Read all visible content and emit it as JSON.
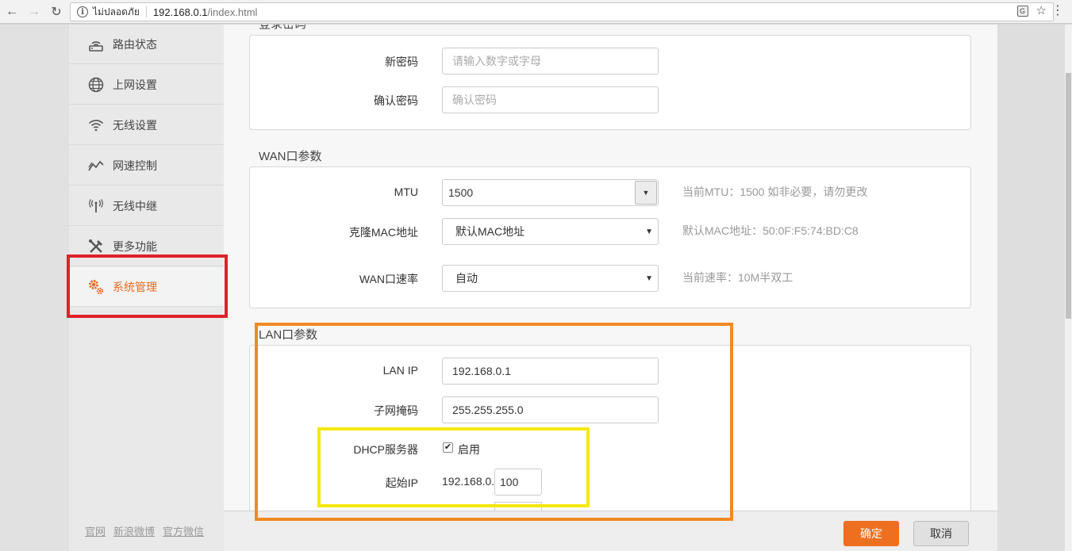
{
  "browser": {
    "back": "←",
    "forward": "→",
    "reload": "↻",
    "security_label": "ไม่ปลอดภัย",
    "url_host": "192.168.0.1",
    "url_path": "/index.html",
    "translate_icon": "translate-icon",
    "star_icon": "star-icon"
  },
  "sidebar": {
    "items": [
      {
        "label": "路由状态",
        "icon": "router-icon"
      },
      {
        "label": "上网设置",
        "icon": "globe-icon"
      },
      {
        "label": "无线设置",
        "icon": "wifi-icon"
      },
      {
        "label": "网速控制",
        "icon": "speed-chart-icon"
      },
      {
        "label": "无线中继",
        "icon": "antenna-icon"
      },
      {
        "label": "更多功能",
        "icon": "tools-icon"
      },
      {
        "label": "系统管理",
        "icon": "gears-icon",
        "active": true
      }
    ],
    "footer_links": [
      "官网",
      "新浪微博",
      "官方微信"
    ]
  },
  "login_password": {
    "title_partial": "登录密码",
    "new_password_label": "新密码",
    "new_password_placeholder": "请输入数字或字母",
    "confirm_password_label": "确认密码",
    "confirm_password_placeholder": "确认密码"
  },
  "wan": {
    "title": "WAN口参数",
    "mtu_label": "MTU",
    "mtu_value": "1500",
    "mtu_hint": "当前MTU：1500 如非必要，请勿更改",
    "mac_label": "克隆MAC地址",
    "mac_value": "默认MAC地址",
    "mac_hint": "默认MAC地址：50:0F:F5:74:BD:C8",
    "speed_label": "WAN口速率",
    "speed_value": "自动",
    "speed_hint": "当前速率：10M半双工"
  },
  "lan": {
    "title": "LAN口参数",
    "ip_label": "LAN IP",
    "ip_value": "192.168.0.1",
    "mask_label": "子网掩码",
    "mask_value": "255.255.255.0",
    "dhcp_label": "DHCP服务器",
    "dhcp_enabled_label": "启用",
    "dhcp_checked": true,
    "start_ip_label": "起始IP",
    "start_ip_prefix": "192.168.0.",
    "start_ip_value": "100"
  },
  "actions": {
    "ok": "确定",
    "cancel": "取消"
  },
  "colors": {
    "accent": "#ee6f20",
    "highlight_red": "#e0202a",
    "highlight_orange": "#f08a24",
    "highlight_yellow": "#f5e80c"
  }
}
